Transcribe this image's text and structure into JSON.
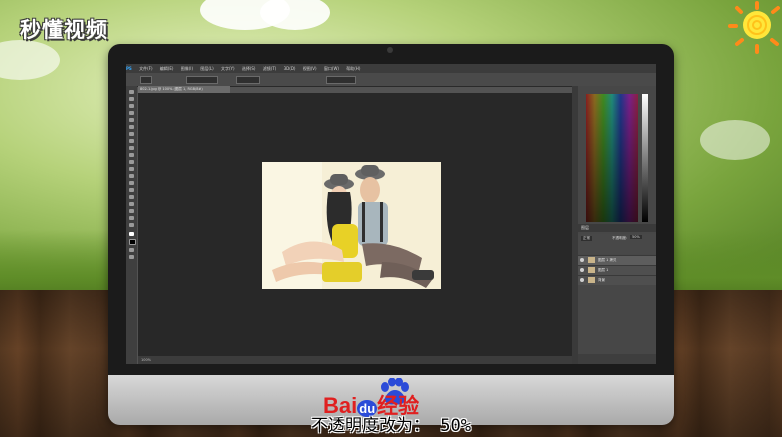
{
  "logo": {
    "text": "秒懂视频"
  },
  "photoshop": {
    "menu": [
      "PS",
      "文件(F)",
      "编辑(E)",
      "图像(I)",
      "图层(L)",
      "文字(Y)",
      "选择(S)",
      "滤镜(T)",
      "3D(D)",
      "视图(V)",
      "窗口(W)",
      "帮助(H)"
    ],
    "document_tab": "802-1.jpg @ 100% (图层 1, RGB/8#)",
    "status_zoom": "100%",
    "panels": {
      "layers_title": "图层",
      "blend_mode": "正常",
      "opacity_label": "不透明度:",
      "opacity_value": "50%",
      "layers": [
        {
          "name": "图层 1 拷贝"
        },
        {
          "name": "图层 1"
        },
        {
          "name": "背景"
        }
      ]
    }
  },
  "watermark": {
    "brand": "Bai",
    "brand_du": "du",
    "brand_cn": "经验"
  },
  "caption": "不透明度改为： 50%",
  "colors": {
    "baidu_red": "#e02020",
    "baidu_blue": "#2b4bd8",
    "ps_dark": "#282828"
  }
}
